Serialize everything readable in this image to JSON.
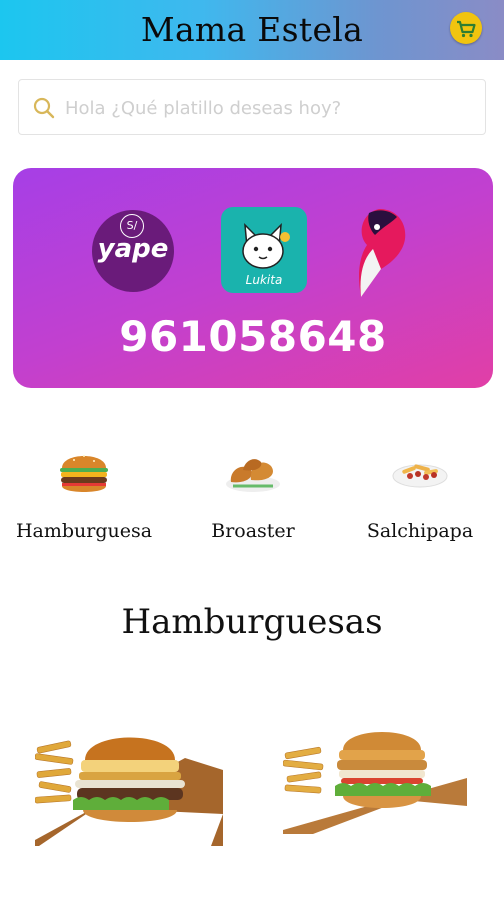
{
  "header": {
    "title": "Mama Estela",
    "cart_icon": "shopping-cart-icon",
    "gradient_start": "#1cc6ef",
    "gradient_end": "#8a8cc6"
  },
  "search": {
    "placeholder": "Hola ¿Qué platillo deseas hoy?",
    "value": "",
    "icon": "search-icon"
  },
  "payment_banner": {
    "yape": {
      "badge": "S/",
      "label": "yape"
    },
    "lukita": {
      "label": "Lukita"
    },
    "plin": {
      "icon": "plin-logo"
    },
    "phone": "961058648",
    "gradient_start": "#a63fe6",
    "gradient_end": "#e13fa6"
  },
  "categories": [
    {
      "label": "Hamburguesa",
      "icon": "burger-icon"
    },
    {
      "label": "Broaster",
      "icon": "fried-chicken-icon"
    },
    {
      "label": "Salchipapa",
      "icon": "salchipapa-icon"
    }
  ],
  "section": {
    "title": "Hamburguesas"
  },
  "products": [
    {
      "image": "burger-with-fries-photo"
    },
    {
      "image": "chicken-burger-with-fries-photo"
    }
  ]
}
